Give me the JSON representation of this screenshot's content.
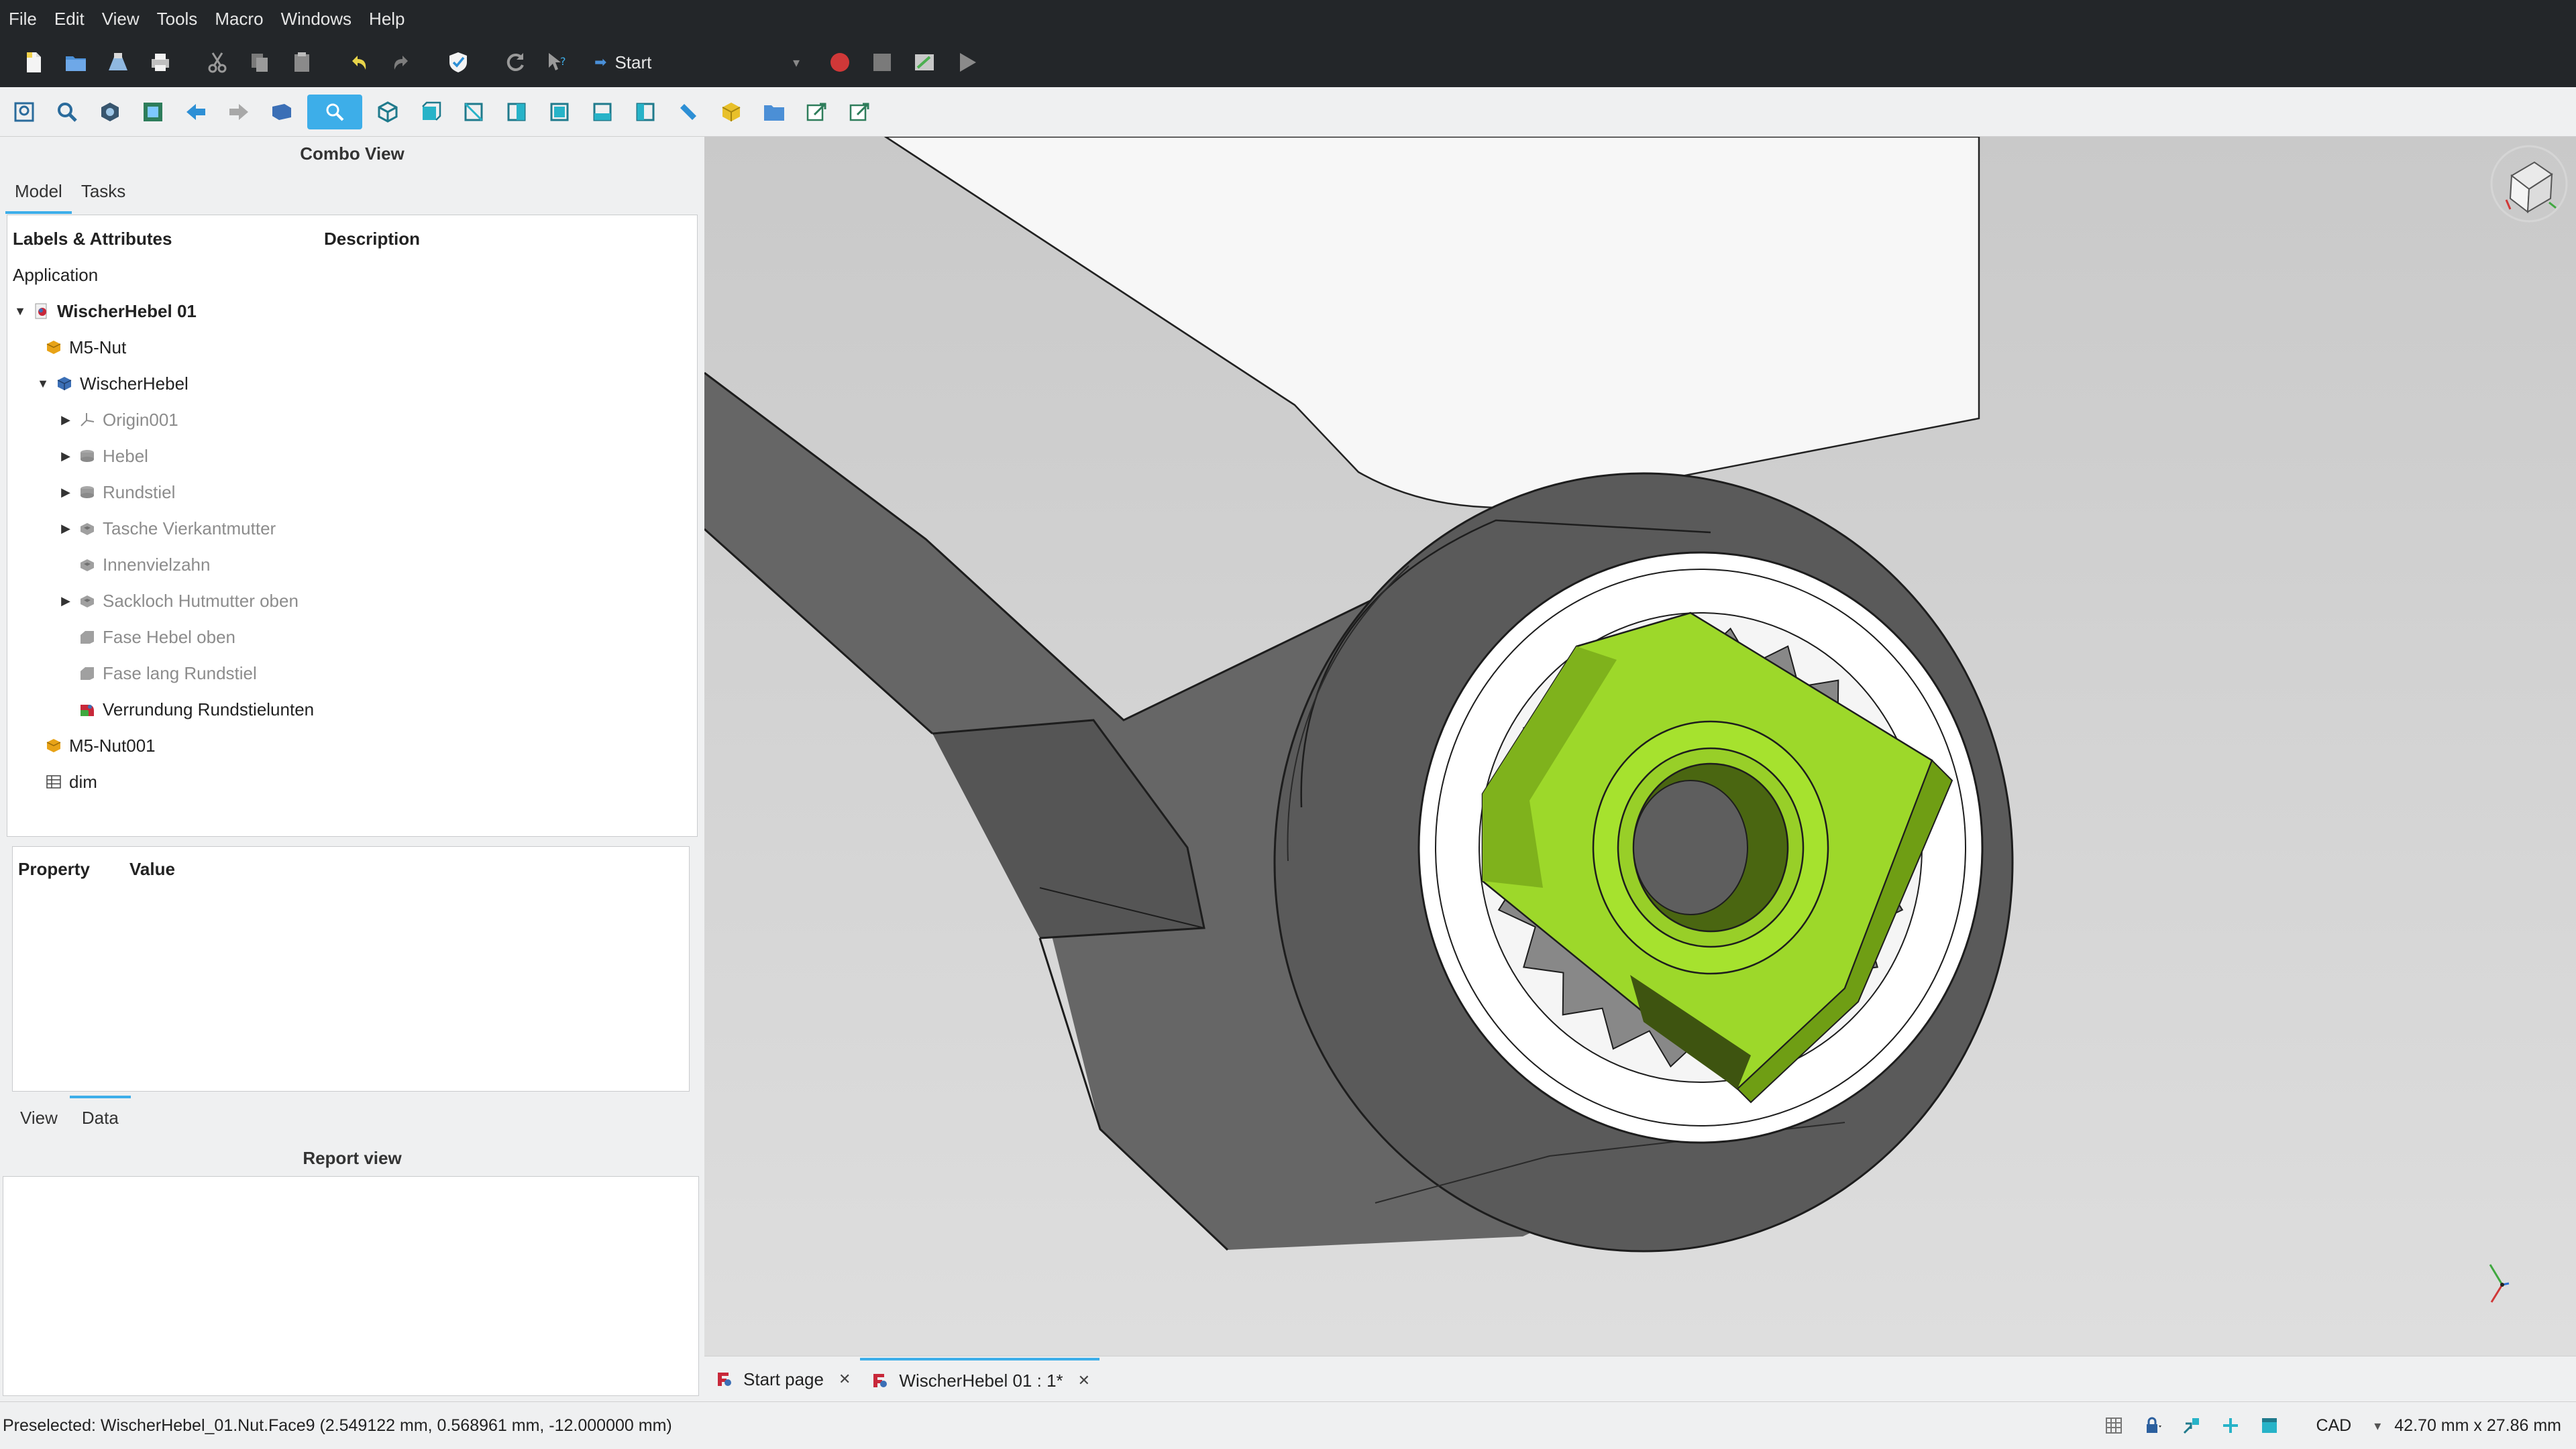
{
  "menu": [
    "File",
    "Edit",
    "View",
    "Tools",
    "Macro",
    "Windows",
    "Help"
  ],
  "toolbar": {
    "workbench": "Start",
    "icons": [
      "new-icon",
      "open-icon",
      "save-icon",
      "print-icon",
      "cut-icon",
      "copy-icon",
      "paste-icon",
      "undo-icon",
      "redo-icon",
      "validate-icon",
      "refresh-icon",
      "whats-this-icon"
    ],
    "macro_icons": [
      "record-icon",
      "stop-icon",
      "macro-edit-icon",
      "play-icon"
    ]
  },
  "view_toolbar": [
    "fit-all-icon",
    "fit-selection-icon",
    "draw-style-icon",
    "bounding-box-icon",
    "back-icon",
    "forward-icon",
    "stereo-icon",
    "std-views-icon",
    "isometric-icon",
    "front-icon",
    "top-icon",
    "right-icon",
    "rear-icon",
    "bottom-icon",
    "left-icon",
    "measure-icon",
    "part-icon",
    "group-icon",
    "link-icon",
    "link-actions-icon"
  ],
  "left_panel": {
    "combo_title": "Combo View",
    "tabs": [
      "Model",
      "Tasks"
    ],
    "tree_columns": [
      "Labels & Attributes",
      "Description"
    ],
    "tree": [
      {
        "label": "Application",
        "depth": 0,
        "icon": "none",
        "arrow": "",
        "style": "normal"
      },
      {
        "label": "WischerHebel 01",
        "depth": 0,
        "icon": "document",
        "arrow": "down",
        "style": "bold"
      },
      {
        "label": "M5-Nut",
        "depth": 1,
        "icon": "part-orange",
        "arrow": "",
        "style": "normal"
      },
      {
        "label": "WischerHebel",
        "depth": 1,
        "icon": "body-blue",
        "arrow": "down",
        "style": "normal"
      },
      {
        "label": "Origin001",
        "depth": 2,
        "icon": "origin",
        "arrow": "right",
        "style": "dim"
      },
      {
        "label": "Hebel",
        "depth": 2,
        "icon": "feature-grey",
        "arrow": "right",
        "style": "dim"
      },
      {
        "label": "Rundstiel",
        "depth": 2,
        "icon": "feature-grey",
        "arrow": "right",
        "style": "dim"
      },
      {
        "label": "Tasche Vierkantmutter",
        "depth": 2,
        "icon": "feature-grey",
        "arrow": "right",
        "style": "dim"
      },
      {
        "label": "Innenvielzahn",
        "depth": 2,
        "icon": "feature-grey",
        "arrow": "",
        "style": "dim"
      },
      {
        "label": "Sackloch Hutmutter oben",
        "depth": 2,
        "icon": "feature-grey",
        "arrow": "right",
        "style": "dim"
      },
      {
        "label": "Fase Hebel oben",
        "depth": 2,
        "icon": "feature-grey",
        "arrow": "",
        "style": "dim"
      },
      {
        "label": "Fase lang Rundstiel",
        "depth": 2,
        "icon": "feature-grey",
        "arrow": "",
        "style": "dim"
      },
      {
        "label": "Verrundung Rundstielunten",
        "depth": 2,
        "icon": "fillet-color",
        "arrow": "",
        "style": "normal"
      },
      {
        "label": "M5-Nut001",
        "depth": 1,
        "icon": "part-orange",
        "arrow": "",
        "style": "normal"
      },
      {
        "label": "dim",
        "depth": 1,
        "icon": "spreadsheet",
        "arrow": "",
        "style": "normal"
      }
    ],
    "property_columns": [
      "Property",
      "Value"
    ],
    "property_tabs": [
      "View",
      "Data"
    ],
    "report_title": "Report view"
  },
  "viewport": {
    "highlight_color": "#a6e22e",
    "body_color": "#5a5a5a"
  },
  "doc_tabs": [
    {
      "label": "Start page",
      "active": false
    },
    {
      "label": "WischerHebel 01 : 1*",
      "active": true
    }
  ],
  "status": {
    "text": "Preselected: WischerHebel_01.Nut.Face9 (2.549122 mm, 0.568961 mm, -12.000000 mm)",
    "nav_style": "CAD",
    "dimensions": "42.70 mm x 27.86 mm"
  }
}
